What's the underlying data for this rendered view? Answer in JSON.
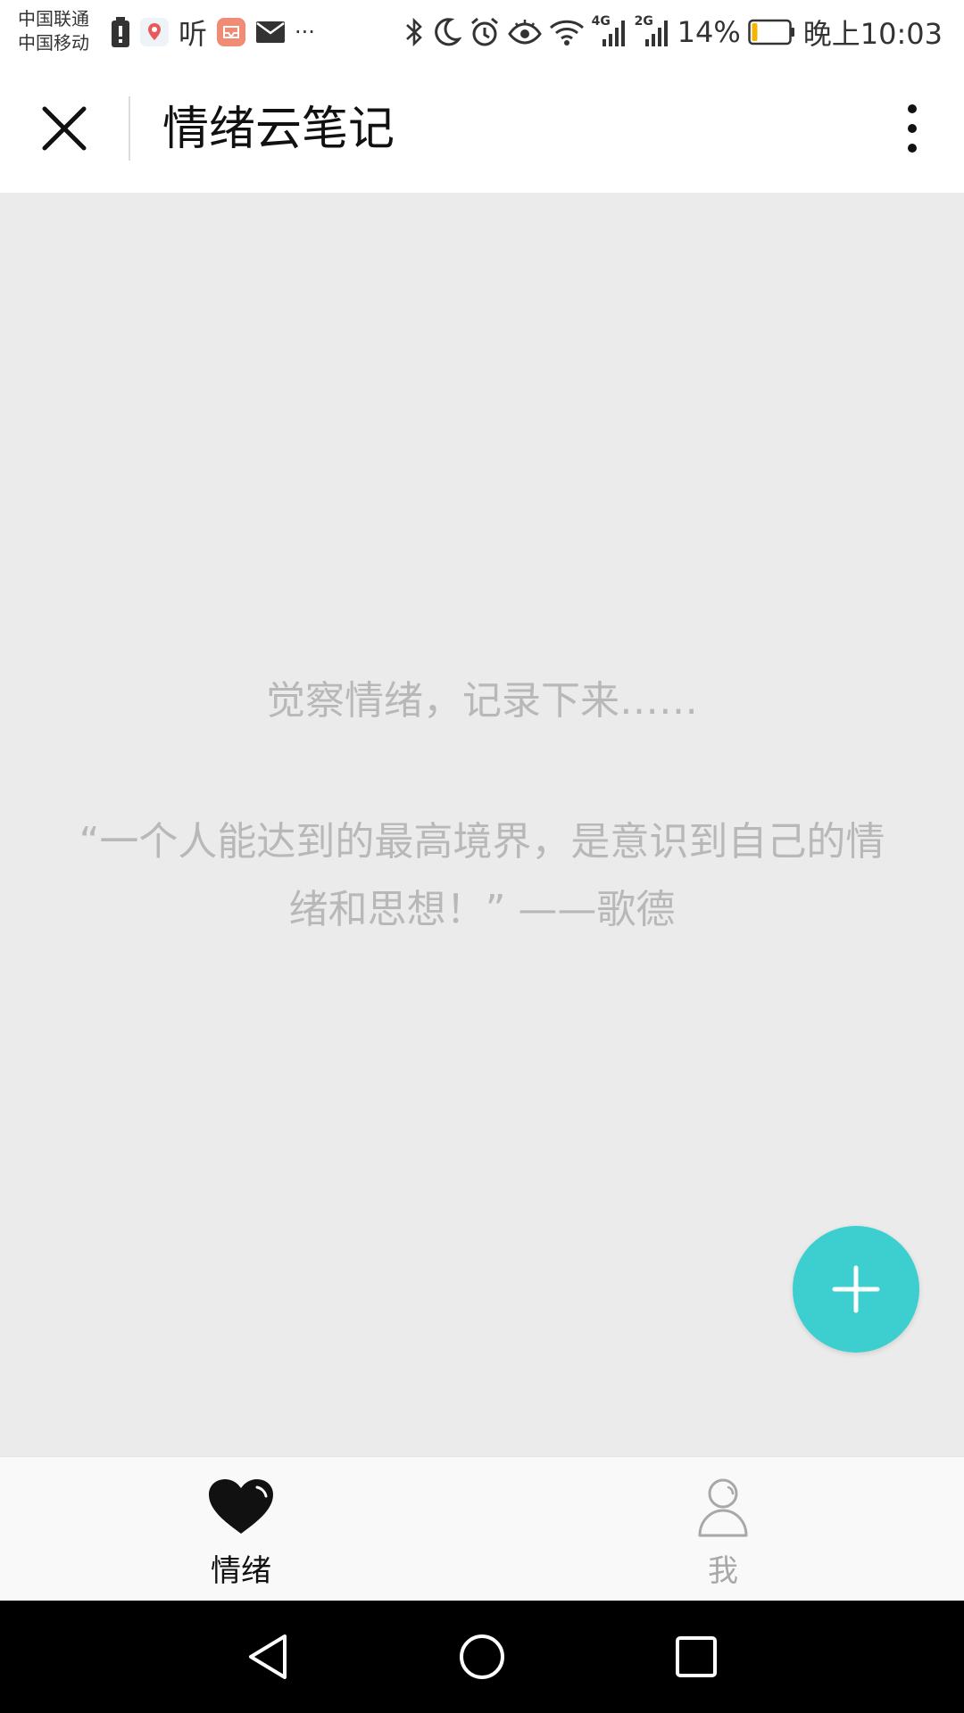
{
  "status_bar": {
    "carrier_1": "中国联通",
    "carrier_2": "中国移动",
    "app_icon_text": "听",
    "more_notifications": "···",
    "net_4g": "4G",
    "net_2g": "2G",
    "battery_percent": "14%",
    "battery_level": 0.14,
    "time": "晚上10:03"
  },
  "titlebar": {
    "title": "情绪云笔记"
  },
  "main": {
    "prompt": "觉察情绪，记录下来……",
    "quote": "“一个人能达到的最高境界，是意识到自己的情绪和思想！” ——歌德"
  },
  "tabs": [
    {
      "label": "情绪",
      "icon": "heart-icon",
      "active": true
    },
    {
      "label": "我",
      "icon": "person-icon",
      "active": false
    }
  ],
  "colors": {
    "accent": "#3dcfcf",
    "placeholder_text": "#b8b8b8",
    "background": "#ebebeb",
    "battery_low": "#f5b400"
  }
}
